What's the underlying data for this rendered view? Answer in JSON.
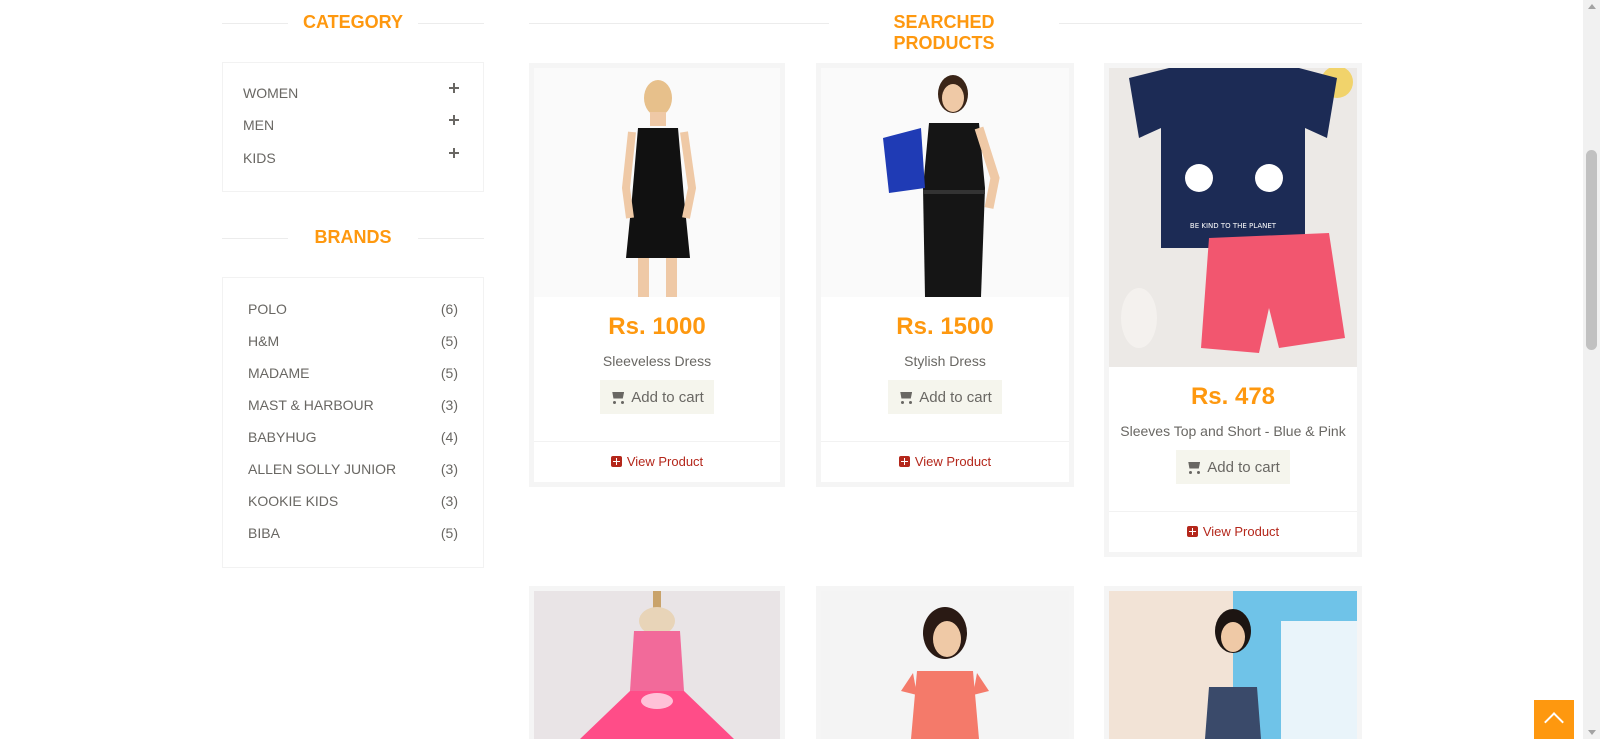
{
  "sidebar": {
    "category_title": "CATEGORY",
    "categories": [
      {
        "label": "WOMEN"
      },
      {
        "label": "MEN"
      },
      {
        "label": "KIDS"
      }
    ],
    "brands_title": "BRANDS",
    "brands": [
      {
        "label": "POLO",
        "count": "(6)"
      },
      {
        "label": "H&M",
        "count": "(5)"
      },
      {
        "label": "MADAME",
        "count": "(5)"
      },
      {
        "label": "MAST & HARBOUR",
        "count": "(3)"
      },
      {
        "label": "BABYHUG",
        "count": "(4)"
      },
      {
        "label": "ALLEN SOLLY JUNIOR",
        "count": "(3)"
      },
      {
        "label": "KOOKIE KIDS",
        "count": "(3)"
      },
      {
        "label": "BIBA",
        "count": "(5)"
      }
    ]
  },
  "main": {
    "title": "SEARCHED PRODUCTS",
    "add_to_cart_label": "Add to cart",
    "view_product_label": "View Product",
    "products": [
      {
        "price": "Rs. 1000",
        "name": "Sleeveless Dress"
      },
      {
        "price": "Rs. 1500",
        "name": "Stylish Dress"
      },
      {
        "price": "Rs. 478",
        "name": "Sleeves Top and Short - Blue & Pink"
      }
    ]
  },
  "colors": {
    "accent": "#fe980f",
    "view_link": "#b4271b",
    "text": "#696763"
  }
}
